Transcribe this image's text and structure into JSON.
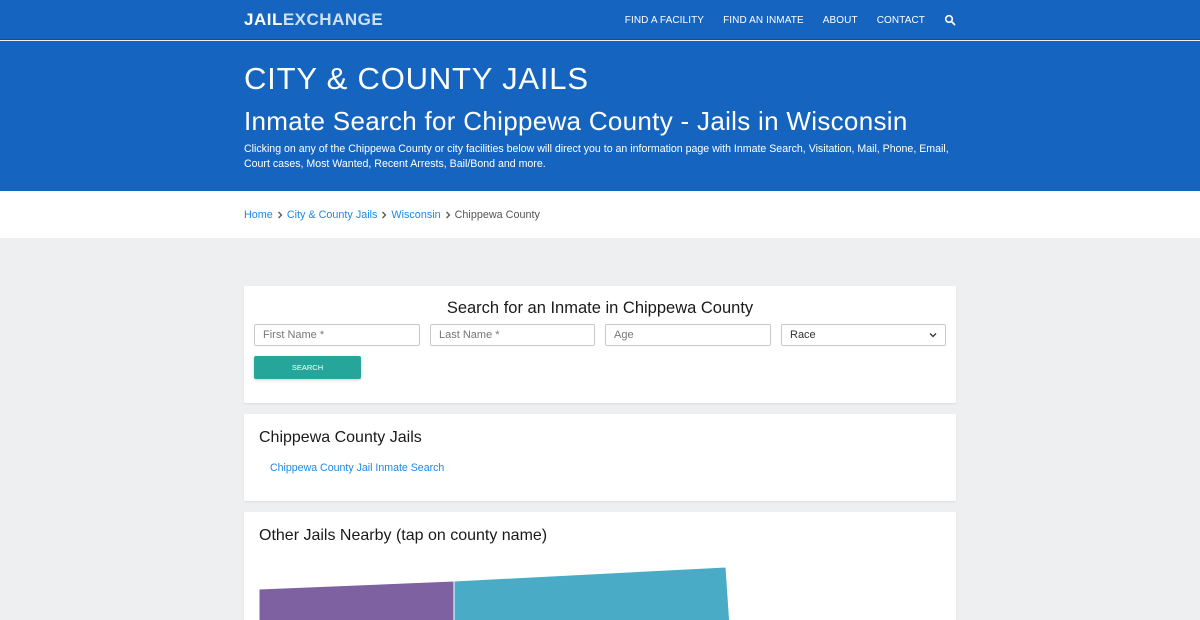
{
  "brand": {
    "part1": "JAIL",
    "part2": "EXCHANGE"
  },
  "nav": {
    "items": [
      "FIND A FACILITY",
      "FIND AN INMATE",
      "ABOUT",
      "CONTACT"
    ],
    "search_icon": "search-icon"
  },
  "hero": {
    "title": "CITY & COUNTY JAILS",
    "subtitle": "Inmate Search for Chippewa County - Jails in Wisconsin",
    "description": "Clicking on any of the Chippewa County or city facilities below will direct you to an information page with Inmate Search, Visitation, Mail, Phone, Email, Court cases, Most Wanted, Recent Arrests, Bail/Bond and more."
  },
  "breadcrumb": {
    "home": "Home",
    "level1": "City & County Jails",
    "level2": "Wisconsin",
    "current": "Chippewa County"
  },
  "search_form": {
    "title": "Search for an Inmate in Chippewa County",
    "first_name_placeholder": "First Name *",
    "last_name_placeholder": "Last Name *",
    "age_placeholder": "Age",
    "race_value": "Race",
    "button": "SEARCH"
  },
  "county_jails": {
    "title": "Chippewa County Jails",
    "links": [
      "Chippewa County Jail Inmate Search"
    ]
  },
  "nearby": {
    "title": "Other Jails Nearby (tap on county name)"
  },
  "colors": {
    "primary": "#1565c0",
    "link": "#1e88e5",
    "button": "#26a69a",
    "map_purple": "#7e61a0",
    "map_teal": "#4aabc6"
  }
}
